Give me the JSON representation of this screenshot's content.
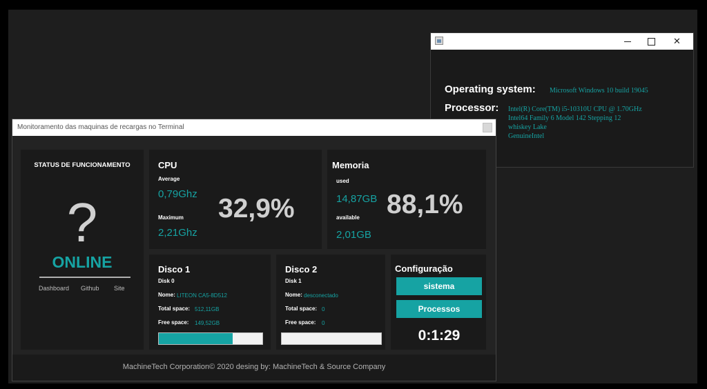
{
  "system_window": {
    "os_label": "Operating system:",
    "os_value": "Microsoft Windows 10 build 19045",
    "processor_label": "Processor:",
    "processor_lines": [
      "Intel(R) Core(TM) i5-10310U CPU @ 1.70GHz",
      "Intel64 Family 6 Model 142 Stepping 12",
      "whiskey Lake",
      "GenuineIntel"
    ],
    "controls": {
      "minimize": "—",
      "close": "✕"
    }
  },
  "main_window": {
    "title": "Monitoramento das maquinas de recargas no Terminal",
    "status": {
      "title": "STATUS DE FUNCIONAMENTO",
      "icon": "?",
      "state": "ONLINE",
      "links": [
        "Dashboard",
        "Github",
        "Site"
      ]
    },
    "cpu": {
      "title": "CPU",
      "average_label": "Average",
      "average_value": "0,79Ghz",
      "maximum_label": "Maximum",
      "maximum_value": "2,21Ghz",
      "percent": "32,9%"
    },
    "memoria": {
      "title": "Memoria",
      "used_label": "used",
      "used_value": "14,87GB",
      "available_label": "available",
      "available_value": "2,01GB",
      "percent": "88,1%"
    },
    "disco1": {
      "title": "Disco 1",
      "disk": "Disk 0",
      "name_label": "Nome:",
      "name_value": "LITEON CA5-8D512",
      "total_label": "Total space:",
      "total_value": "512,11GB",
      "free_label": "Free space:",
      "free_value": "149,52GB",
      "usage_fraction": 0.71
    },
    "disco2": {
      "title": "Disco 2",
      "disk": "Disk 1",
      "name_label": "Nome:",
      "name_value": "desconectado",
      "total_label": "Total space:",
      "total_value": "0",
      "free_label": "Free space:",
      "free_value": "0",
      "usage_fraction": 0
    },
    "config": {
      "title": "Configuração",
      "btn_sistema": "sistema",
      "btn_processos": "Processos",
      "timer": "0:1:29"
    },
    "footer": "MachineTech Corporation© 2020 desing by: MachineTech & Source Company"
  },
  "colors": {
    "accent": "#16a3a3",
    "panel": "#1a1a1a",
    "background": "#232323"
  }
}
